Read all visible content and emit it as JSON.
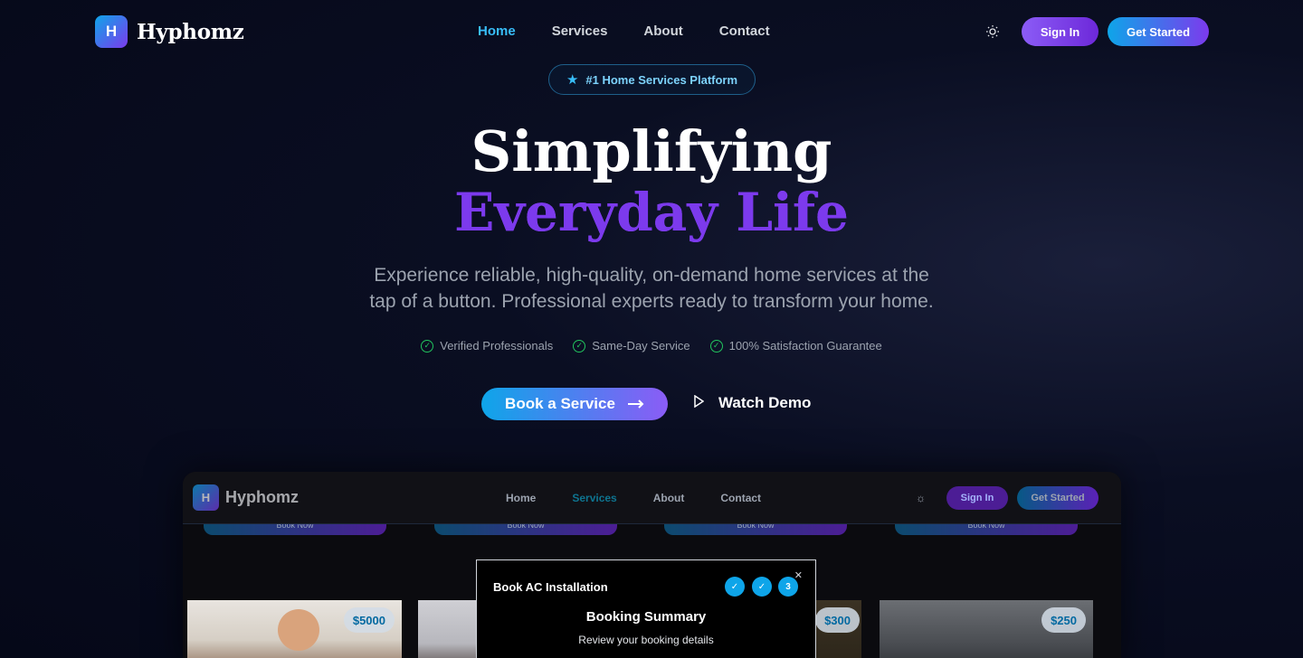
{
  "brand": {
    "logo_letter": "H",
    "name": "Hyphomz"
  },
  "nav": {
    "links": [
      "Home",
      "Services",
      "About",
      "Contact"
    ],
    "active": "Home",
    "sign_in": "Sign In",
    "get_started": "Get Started",
    "theme_icon": "sun-icon"
  },
  "badge": {
    "icon": "star-icon",
    "text": "#1 Home Services Platform"
  },
  "hero": {
    "title_line1": "Simplifying",
    "title_line2": "Everyday Life",
    "subtitle_line1": "Experience reliable, high-quality, on-demand home services at the",
    "subtitle_line2": "tap of a button. Professional experts ready to transform your home.",
    "features": [
      "Verified Professionals",
      "Same-Day Service",
      "100% Satisfaction Guarantee"
    ],
    "cta_primary": "Book a Service",
    "cta_secondary": "Watch Demo"
  },
  "preview": {
    "brand": "Hyphomz",
    "logo_letter": "H",
    "links": [
      "Home",
      "Services",
      "About",
      "Contact"
    ],
    "active": "Services",
    "sign_in": "Sign In",
    "get_started": "Get Started",
    "book_now": "Book Now",
    "prices": [
      "$5000",
      "$300",
      "$250"
    ],
    "modal": {
      "title": "Book AC Installation",
      "steps": [
        "✓",
        "✓",
        "3"
      ],
      "heading": "Booking Summary",
      "subheading": "Review your booking details"
    }
  },
  "colors": {
    "accent_blue": "#0ea5e9",
    "accent_purple": "#7c3aed",
    "background": "#050818"
  }
}
